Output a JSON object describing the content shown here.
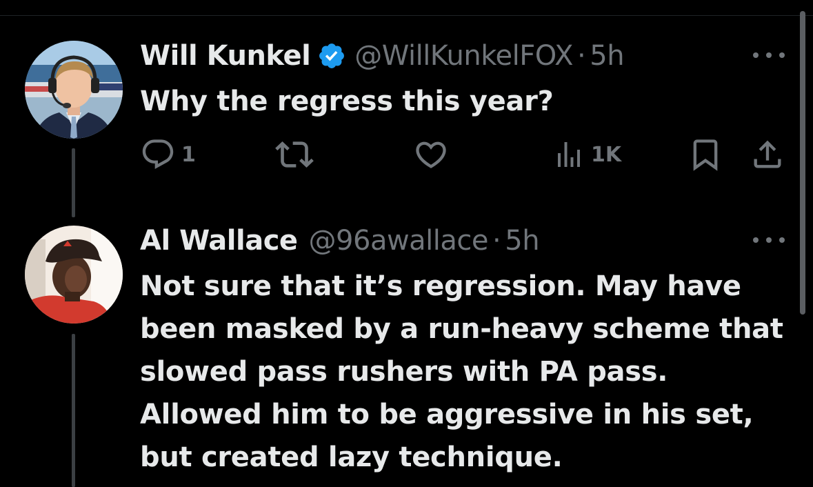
{
  "tweets": [
    {
      "name": "Will Kunkel",
      "verified": true,
      "handle": "@WillKunkelFOX",
      "separator": "·",
      "time": "5h",
      "text": "Why the regress this year?",
      "reply_count": "1",
      "views_count": "1K"
    },
    {
      "name": "Al Wallace",
      "verified": false,
      "handle": "@96awallace",
      "separator": "·",
      "time": "5h",
      "text": "Not sure that it’s regression.  May have been masked by a run-heavy scheme that slowed pass rushers with PA pass. Allowed him to be aggressive in his set, but created lazy technique."
    }
  ],
  "colors": {
    "background": "#000000",
    "primary_text": "#e7e9ea",
    "secondary_text": "#71767b",
    "verified_badge": "#1d9bf0"
  },
  "icons": {
    "reply": "reply-icon",
    "repost": "repost-icon",
    "like": "heart-icon",
    "views": "views-icon",
    "bookmark": "bookmark-icon",
    "share": "share-icon",
    "more": "more-icon",
    "verified": "verified-badge-icon"
  }
}
